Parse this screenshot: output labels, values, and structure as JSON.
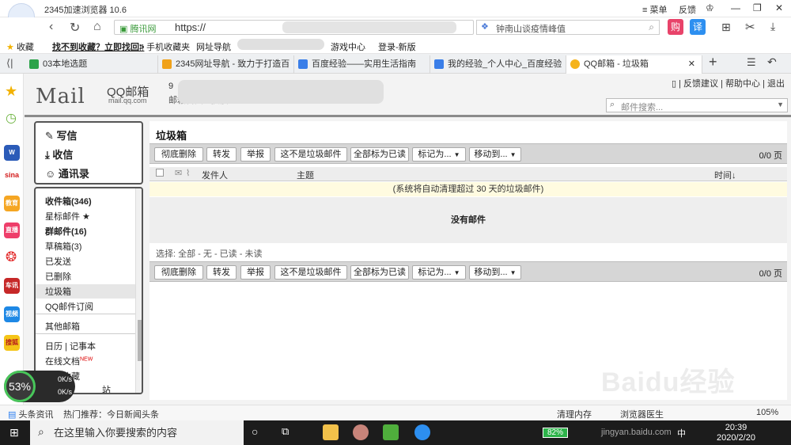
{
  "browser": {
    "title": "2345加速浏览器 10.6",
    "login": "登录",
    "menu": "菜单",
    "feedback": "反馈",
    "url_secure": "腾讯网",
    "url_text": "https://",
    "search_placeholder": "钟南山谈疫情峰值",
    "tools": {
      "translate": "译"
    }
  },
  "bookmarks": [
    {
      "label": "收藏"
    },
    {
      "label": "找不到收藏？立即找回>"
    },
    {
      "label": "手机收藏夹"
    },
    {
      "label": "网址导航"
    },
    {
      "label": "游戏中心"
    },
    {
      "label": "登录-新版"
    }
  ],
  "tabs": [
    {
      "label": "03本地选题"
    },
    {
      "label": "2345网址导航 - 致力于打造百"
    },
    {
      "label": "百度经验——实用生活指南"
    },
    {
      "label": "我的经验_个人中心_百度经验"
    },
    {
      "label": "QQ邮箱 - 垃圾箱",
      "active": true
    }
  ],
  "side_icons": [
    "教育",
    "直播",
    "车讯",
    "视频",
    "搜狐"
  ],
  "mail": {
    "logo": "Mail",
    "logo_qq": "QQ邮箱",
    "logo_sub": "mail.qq.com",
    "account_line1": "9",
    "account_line2": "邮箱首页 - 换肤",
    "top_links": "| 反馈建议 | 帮助中心 | 退出",
    "search_placeholder": "邮件搜索...",
    "compose": "写信",
    "inbox_nav": "收信",
    "contacts": "通讯录",
    "folders": [
      {
        "label": "收件箱(346)",
        "bold": true
      },
      {
        "label": "星标邮件 ★"
      },
      {
        "label": "群邮件(16)",
        "bold": true
      },
      {
        "label": "草稿箱(3)"
      },
      {
        "label": "已发送"
      },
      {
        "label": "已删除"
      },
      {
        "label": "垃圾箱",
        "active": true
      },
      {
        "label": "QQ邮件订阅"
      }
    ],
    "other_mailbox": "其他邮箱",
    "calendar": "日历 | 记事本",
    "online_docs": "在线文档",
    "new_badge": "NEW",
    "attachments": "附件收藏",
    "station": "站",
    "page_title": "垃圾箱",
    "toolbar": {
      "delete": "彻底删除",
      "forward": "转发",
      "report": "举报",
      "not_spam": "这不是垃圾邮件",
      "mark_all_read": "全部标为已读",
      "mark_as": "标记为...",
      "move_to": "移动到..."
    },
    "page_count": "0/0 页",
    "columns": {
      "sender": "发件人",
      "subject": "主题",
      "time": "时间↓"
    },
    "notice": "(系统将自动清理超过 30 天的垃圾邮件)",
    "empty": "没有邮件",
    "select_line": "选择: 全部 - 无 - 已读 - 未读"
  },
  "status": {
    "news": "头条资讯",
    "hot": "热门推荐：今日新闻头条",
    "clean": "清理内存",
    "doctor": "浏览器医生",
    "zoom": "105%"
  },
  "perf": {
    "percent": "53%",
    "up": "0K/s",
    "down": "0K/s"
  },
  "taskbar": {
    "search": "在这里输入你要搜索的内容",
    "battery": "82%",
    "ime": "中",
    "time": "20:39",
    "date": "2020/2/20"
  },
  "watermark": "Baidu经验",
  "watermark_url": "jingyan.baidu.com"
}
